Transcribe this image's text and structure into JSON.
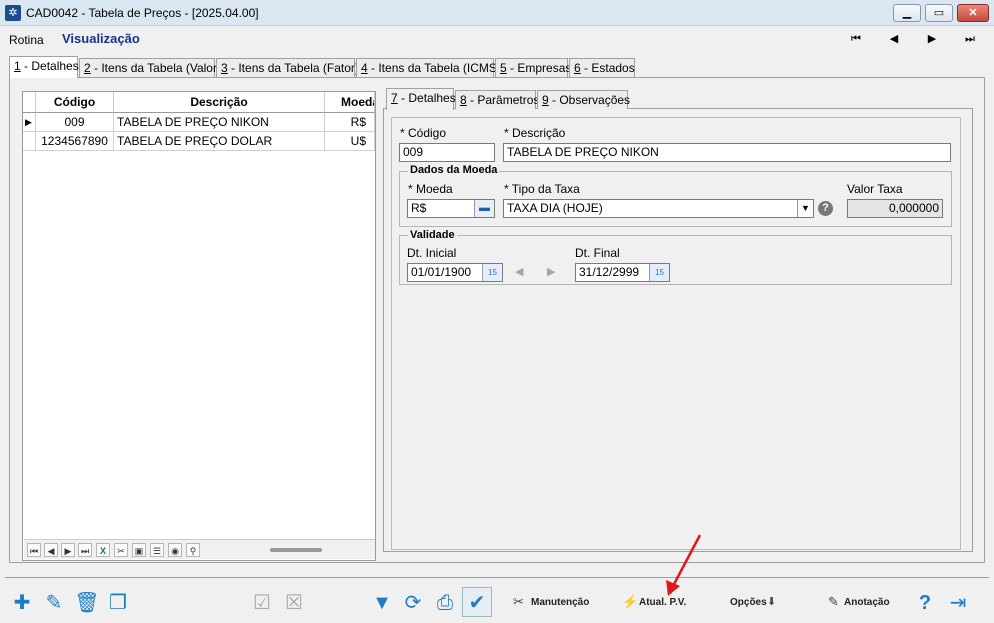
{
  "window": {
    "title": "CAD0042 - Tabela de Preços - [2025.04.00]",
    "icon": "app-grid-icon"
  },
  "menu": {
    "rotina": "Rotina",
    "mode": "Visualização"
  },
  "nav": {
    "first": "⏮",
    "prev": "◀",
    "next": "▶",
    "last": "⏭"
  },
  "tabs": [
    {
      "key": "1",
      "label": " - Detalhes"
    },
    {
      "key": "2",
      "label": " - Itens da Tabela (Valor)"
    },
    {
      "key": "3",
      "label": " - Itens da Tabela (Fator)"
    },
    {
      "key": "4",
      "label": " - Itens da Tabela (ICMS)"
    },
    {
      "key": "5",
      "label": " - Empresas"
    },
    {
      "key": "6",
      "label": " - Estados"
    }
  ],
  "grid": {
    "columns": [
      "Código",
      "Descrição",
      "Moeda"
    ],
    "rows": [
      {
        "codigo": "009",
        "descricao": "TABELA DE PREÇO NIKON",
        "moeda": "R$"
      },
      {
        "codigo": "1234567890",
        "descricao": "TABELA DE PREÇO DOLAR",
        "moeda": "U$"
      }
    ]
  },
  "inner_tabs": [
    {
      "key": "7",
      "label": " - Detalhes"
    },
    {
      "key": "8",
      "label": " - Parâmetros"
    },
    {
      "key": "9",
      "label": " - Observações"
    }
  ],
  "form": {
    "codigo_label": "* Código",
    "codigo_value": "009",
    "descricao_label": "* Descrição",
    "descricao_value": "TABELA DE PREÇO NIKON",
    "dados_moeda_title": "Dados da Moeda",
    "moeda_label": "* Moeda",
    "moeda_value": "R$",
    "tipo_taxa_label": "* Tipo da Taxa",
    "tipo_taxa_value": "TAXA DIA (HOJE)",
    "valor_taxa_label": "Valor Taxa",
    "valor_taxa_value": "0,000000",
    "validade_title": "Validade",
    "dt_inicial_label": "Dt. Inicial",
    "dt_inicial_value": "01/01/1900",
    "dt_final_label": "Dt. Final",
    "dt_final_value": "31/12/2999"
  },
  "toolbar": {
    "manutencao": "Manutenção",
    "atual_pv": "Atual. P.V.",
    "opcoes": "Opções",
    "anotacao": "Anotação"
  }
}
